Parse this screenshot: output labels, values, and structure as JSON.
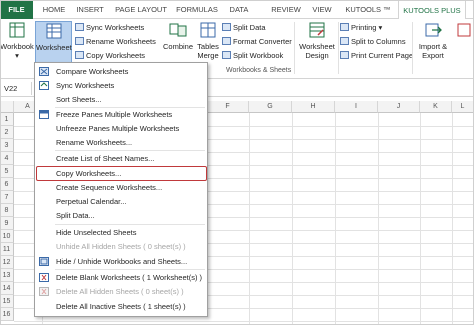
{
  "tabs": [
    "FILE",
    "HOME",
    "INSERT",
    "PAGE LAYOUT",
    "FORMULAS",
    "DATA",
    "REVIEW",
    "VIEW",
    "KUTOOLS ™",
    "KUTOOLS PLUS"
  ],
  "ribbon": {
    "workbook_label": "Workbook",
    "worksheet_label": "Worksheet",
    "sync_worksheets": "Sync Worksheets",
    "rename_worksheets": "Rename Worksheets",
    "copy_worksheets": "Copy Worksheets",
    "combine": "Combine",
    "tables_merge_1": "Tables",
    "tables_merge_2": "Merge",
    "split_data": "Split Data",
    "format_converter": "Format Converter",
    "split_workbook": "Split Workbook",
    "group_label": "Workbooks & Sheets",
    "worksheet_design_1": "Worksheet",
    "worksheet_design_2": "Design",
    "printing": "Printing",
    "split_to_columns": "Split to Columns",
    "print_current_page": "Print Current Page",
    "import_export_1": "Import &",
    "import_export_2": "Export",
    "caret": "▾"
  },
  "formula_bar": {
    "name_box": "V22"
  },
  "grid": {
    "columns": [
      "A",
      "F",
      "G",
      "H",
      "I",
      "J",
      "K",
      "L"
    ],
    "rows": [
      "1",
      "2",
      "3",
      "4",
      "5",
      "6",
      "7",
      "8",
      "9",
      "10",
      "11",
      "12",
      "13",
      "14",
      "15",
      "16"
    ]
  },
  "menu": {
    "items": [
      {
        "label": "Compare Worksheets",
        "disabled": false,
        "icon": "compare-icon"
      },
      {
        "label": "Sync Worksheets",
        "disabled": false,
        "icon": "sync-icon"
      },
      {
        "label": "Sort Sheets...",
        "disabled": false,
        "icon": ""
      },
      {
        "label": "Freeze Panes Multiple Worksheets",
        "disabled": false,
        "icon": "freeze-icon"
      },
      {
        "label": "Unfreeze Panes Multiple Worksheets",
        "disabled": false,
        "icon": ""
      },
      {
        "label": "Rename Worksheets...",
        "disabled": false,
        "icon": ""
      },
      {
        "label": "Create List of Sheet Names...",
        "disabled": false,
        "icon": ""
      },
      {
        "label": "Copy Worksheets...",
        "disabled": false,
        "icon": ""
      },
      {
        "label": "Create Sequence Worksheets...",
        "disabled": false,
        "icon": ""
      },
      {
        "label": "Perpetual Calendar...",
        "disabled": false,
        "icon": ""
      },
      {
        "label": "Split Data...",
        "disabled": false,
        "icon": ""
      },
      {
        "label": "Hide Unselected Sheets",
        "disabled": false,
        "icon": ""
      },
      {
        "label": "Unhide All Hidden Sheets ( 0 sheet(s) )",
        "disabled": true,
        "icon": ""
      },
      {
        "label": "Hide / Unhide Workbooks and Sheets...",
        "disabled": false,
        "icon": "hide-unhide-icon"
      },
      {
        "label": "Delete Blank Worksheets ( 1 Worksheet(s) )",
        "disabled": false,
        "icon": "delete-blank-icon"
      },
      {
        "label": "Delete All Hidden Sheets ( 0 sheet(s) )",
        "disabled": true,
        "icon": "delete-hidden-icon"
      },
      {
        "label": "Delete All Inactive Sheets ( 1 sheet(s) )",
        "disabled": false,
        "icon": ""
      }
    ]
  },
  "colors": {
    "file_tab": "#217346",
    "highlight_box": "#c0393b",
    "disabled_text": "#a6a6a6"
  }
}
